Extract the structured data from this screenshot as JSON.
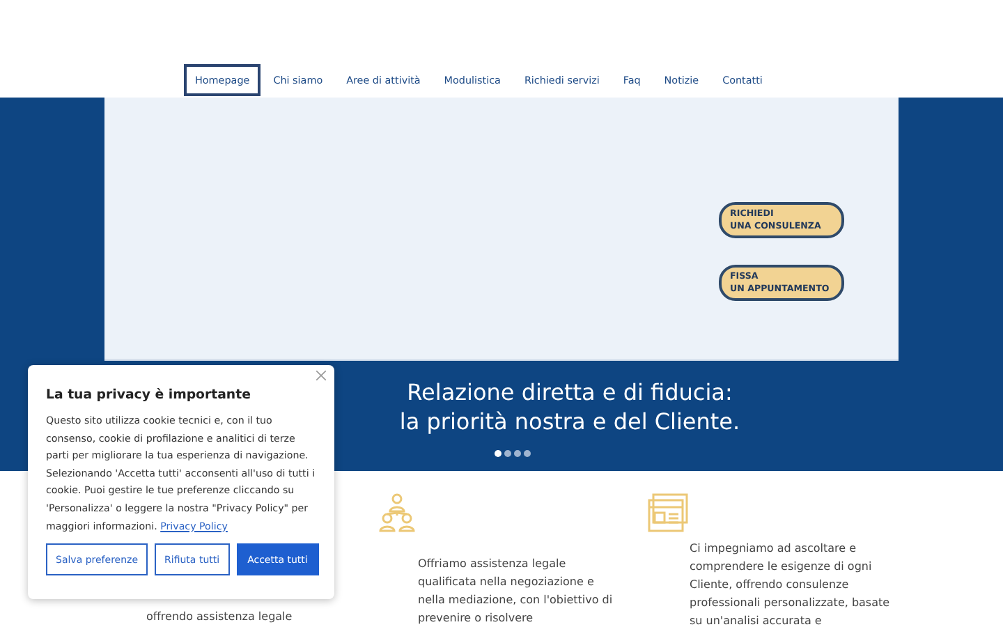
{
  "nav": {
    "items": [
      {
        "label": "Homepage",
        "selected": true
      },
      {
        "label": "Chi siamo",
        "selected": false
      },
      {
        "label": "Aree di attività",
        "selected": false
      },
      {
        "label": "Modulistica",
        "selected": false
      },
      {
        "label": "Richiedi servizi",
        "selected": false
      },
      {
        "label": "Faq",
        "selected": false
      },
      {
        "label": "Notizie",
        "selected": false
      },
      {
        "label": "Contatti",
        "selected": false
      }
    ]
  },
  "hero": {
    "buttons": [
      {
        "lines": [
          "RICHIEDI",
          "UNA CONSULENZA"
        ]
      },
      {
        "lines": [
          "FISSA",
          "UN APPUNTAMENTO"
        ]
      }
    ],
    "caption": [
      "Relazione diretta e di fiducia:",
      "la priorità nostra e del Cliente."
    ],
    "slides": [
      {
        "selected": true
      },
      {
        "selected": false
      },
      {
        "selected": false
      },
      {
        "selected": false
      }
    ]
  },
  "features": [
    {
      "kind": "none",
      "text": "offrendo assistenza legale"
    },
    {
      "kind": "people",
      "text": "Offriamo assistenza legale qualificata nella negoziazione e nella mediazione, con l'obiettivo di prevenire o risolvere"
    },
    {
      "kind": "browser",
      "text": "Ci impegniamo ad ascoltare e comprendere le esigenze di ogni Cliente, offrendo consulenze professionali personalizzate, basate su un'analisi accurata e"
    }
  ],
  "cookie_banner": {
    "title": "La tua privacy è importante",
    "text": "Questo sito utilizza cookie tecnici e, con il tuo consenso, cookie di profilazione e analitici di terze parti per migliorare la tua esperienza di navigazione. Selezionando 'Accetta tutti' acconsenti all'uso di tutti i cookie. Puoi gestire le tue preferenze cliccando su 'Personalizza' o leggere la nostra \"Privacy Policy\" per maggiori informazioni.",
    "link": "Privacy Policy",
    "buttons": [
      {
        "label": "Salva preferenze",
        "kind": "outline"
      },
      {
        "label": "Rifiuta tutti",
        "kind": "outline"
      },
      {
        "label": "Accetta tutti",
        "kind": "primary"
      }
    ]
  }
}
